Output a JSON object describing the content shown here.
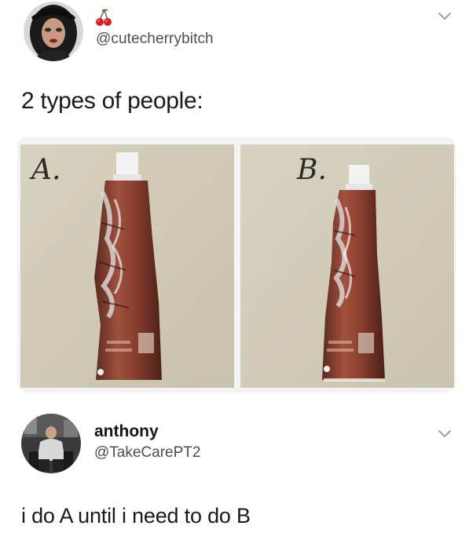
{
  "tweet": {
    "handle": "@cutecherrybitch",
    "text": "2 types of people:",
    "menu_icon": "chevron-down-icon",
    "badge_icon": "cherry-icon"
  },
  "photos": [
    {
      "label": "A."
    },
    {
      "label": "B."
    }
  ],
  "reply": {
    "name": "anthony",
    "handle": "@TakeCarePT2",
    "text": "i do A until i need to do B",
    "menu_icon": "chevron-down-icon"
  }
}
